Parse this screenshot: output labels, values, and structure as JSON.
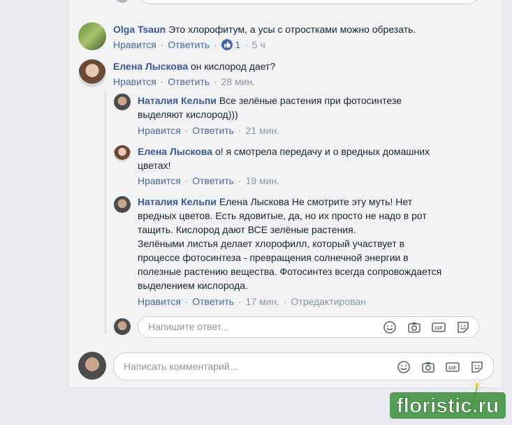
{
  "comments": {
    "olga": {
      "name": "Olga Tsaun",
      "text": "Это хлорофитум, а усы с отростками можно обрезать.",
      "like": "Нравится",
      "reply": "Ответить",
      "reactions": "1",
      "time": "5 ч"
    },
    "elena1": {
      "name": "Елена Лыскова",
      "text": "он кислород дает?",
      "like": "Нравится",
      "reply": "Ответить",
      "time": "28 мин."
    },
    "natalia1": {
      "name": "Наталия Кельпи",
      "text_line1": "Все зелёные растения при фотосинтезе",
      "text_line2": "выделяют кислород)))",
      "like": "Нравится",
      "reply": "Ответить",
      "time": "21 мин."
    },
    "elena2": {
      "name": "Елена Лыскова",
      "text_line1": "о! я смотрела передачу и о вредных домашних",
      "text_line2": "цветах!",
      "like": "Нравится",
      "reply": "Ответить",
      "time": "19 мин."
    },
    "natalia2": {
      "name": "Наталия Кельпи",
      "lines": [
        "Елена Лыскова Не смотрите эту муть! Нет",
        "вредных цветов. Есть ядовитые, да, но их просто не надо в рот",
        "тащить. Кислород дают ВСЕ зелёные растения.",
        "Зелёными листья делает хлорофилл, который участвует в",
        "процессе фотосинтеза - превращения солнечной энергии в",
        "полезные растению вещества. Фотосинтез всегда сопровождается",
        "выделением кислорода."
      ],
      "like": "Нравится",
      "reply": "Ответить",
      "time": "17 мин.",
      "edited": "Отредактирован"
    }
  },
  "reply_box": {
    "placeholder": "Напишите ответ..."
  },
  "comment_box": {
    "placeholder": "Написать комментарий..."
  },
  "watermark": {
    "text": "floristic.ru"
  },
  "icons": [
    "smiley-icon",
    "camera-icon",
    "gif-icon",
    "sticker-icon"
  ],
  "colors": {
    "link": "#385898",
    "action": "#4b67a1",
    "like_badge": "#4267b2",
    "watermark": "#2e8b3a"
  }
}
